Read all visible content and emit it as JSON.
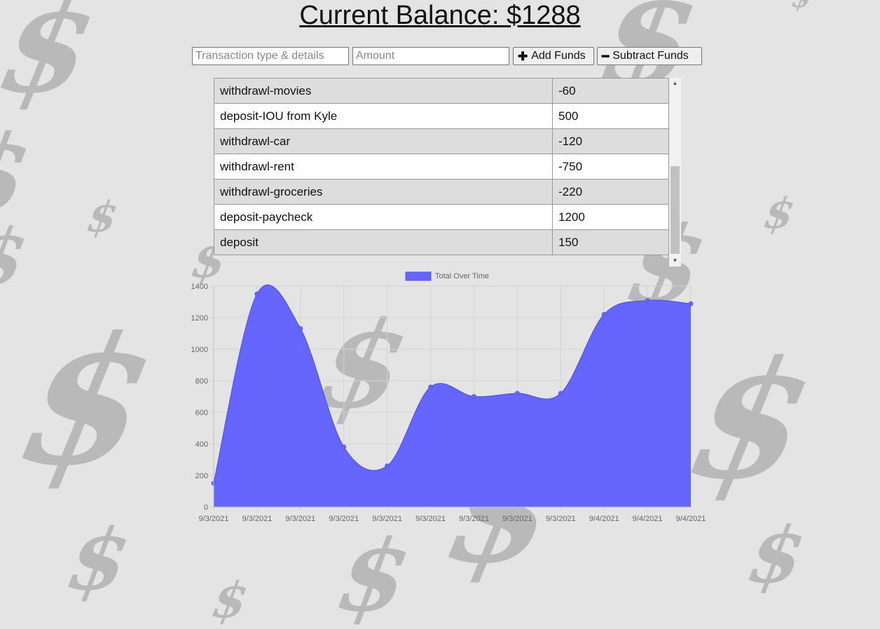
{
  "balance": {
    "label": "Current Balance: $1288"
  },
  "form": {
    "name_placeholder": "Transaction type & details",
    "amount_placeholder": "Amount",
    "add_label": "Add Funds",
    "subtract_label": "Subtract Funds",
    "add_icon": "plus-icon",
    "subtract_icon": "minus-icon"
  },
  "transactions": [
    {
      "name": "withdrawl-movies",
      "amount": "-60"
    },
    {
      "name": "deposit-IOU from Kyle",
      "amount": "500"
    },
    {
      "name": "withdrawl-car",
      "amount": "-120"
    },
    {
      "name": "withdrawl-rent",
      "amount": "-750"
    },
    {
      "name": "withdrawl-groceries",
      "amount": "-220"
    },
    {
      "name": "deposit-paycheck",
      "amount": "1200"
    },
    {
      "name": "deposit",
      "amount": "150"
    }
  ],
  "colors": {
    "background": "#e4e4e4",
    "dollar_sign": "#b9b9b9",
    "chart_fill": "#6666ff",
    "chart_line": "#5a5ae0"
  },
  "chart_data": {
    "type": "area",
    "title": "",
    "xlabel": "",
    "ylabel": "",
    "x": [
      "9/3/2021",
      "9/3/2021",
      "9/3/2021",
      "9/3/2021",
      "9/3/2021",
      "9/3/2021",
      "9/3/2021",
      "9/3/2021",
      "9/3/2021",
      "9/4/2021",
      "9/4/2021",
      "9/4/2021"
    ],
    "series": [
      {
        "name": "Total Over Time",
        "values": [
          150,
          1350,
          1130,
          380,
          260,
          760,
          700,
          720,
          720,
          1220,
          1308,
          1288
        ]
      }
    ],
    "ylim": [
      0,
      1400
    ],
    "y_ticks": [
      0,
      200,
      400,
      600,
      800,
      1000,
      1200,
      1400
    ],
    "grid": true,
    "legend": "top-center"
  }
}
